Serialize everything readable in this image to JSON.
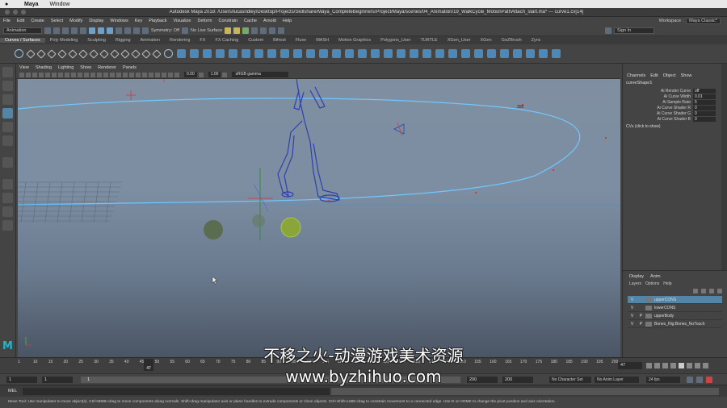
{
  "mac_menu": {
    "apple": "",
    "app": "Maya",
    "window": "Window"
  },
  "title": "Autodesk Maya 2018: /Users/lucasridley/Desktop/Projects/Skillshare/Maya_CompleteBeginners/Project/Maya/scenes/04_Animation/19_WalkCycle_MotionPathAttach_start.ma* --- curve1.cv[14]",
  "menus": [
    "File",
    "Edit",
    "Create",
    "Select",
    "Modify",
    "Display",
    "Windows",
    "Key",
    "Playback",
    "Visualize",
    "Deform",
    "Constrain",
    "Cache",
    "Arnold",
    "Help"
  ],
  "workspace": {
    "label": "Workspace :",
    "value": "Maya Classic*"
  },
  "status_line": {
    "mode": "Animation",
    "symmetry": "Symmetry: Off",
    "live_surface": "No Live Surface",
    "sign_in": "Sign In"
  },
  "shelf_tabs": [
    "Curves / Surfaces",
    "Poly Modeling",
    "Sculpting",
    "Rigging",
    "Animation",
    "Rendering",
    "FX",
    "FX Caching",
    "Custom",
    "Bifrost",
    "Fluxe",
    "MASH",
    "Motion Graphics",
    "Polygons_User",
    "TURTLE",
    "XGen_User",
    "XGen",
    "GoZBrush",
    "Zync"
  ],
  "panel_menu": [
    "View",
    "Shading",
    "Lighting",
    "Show",
    "Renderer",
    "Panels"
  ],
  "panel_tools": {
    "value1": "0.00",
    "value2": "1.00",
    "color_space": "sRGB gamma"
  },
  "viewport": {
    "curve_label": "200"
  },
  "channel_box": {
    "tabs": [
      "Channels",
      "Edit",
      "Object",
      "Show"
    ],
    "object": "curveShape1",
    "attrs": [
      {
        "name": "Ai Render Curve",
        "value": "off"
      },
      {
        "name": "Ai Curve Width",
        "value": "0.01"
      },
      {
        "name": "Ai Sample Rate",
        "value": "5"
      },
      {
        "name": "Ai Curve Shader R",
        "value": "0"
      },
      {
        "name": "Ai Curve Shader G",
        "value": "0"
      },
      {
        "name": "Ai Curve Shader B",
        "value": "0"
      }
    ],
    "cvs": "CVs (click to show)"
  },
  "layer_panel": {
    "tabs": [
      "Display",
      "Anim"
    ],
    "menus": [
      "Layers",
      "Options",
      "Help"
    ],
    "layers": [
      {
        "v": "V",
        "p": "",
        "name": "upperCONS"
      },
      {
        "v": "V",
        "p": "",
        "name": "lowerCONS"
      },
      {
        "v": "V",
        "p": "P",
        "name": "upperBody"
      },
      {
        "v": "V",
        "p": "P",
        "name": "Bones_Rig:Bones_NoTouch"
      }
    ]
  },
  "timeline": {
    "ticks": [
      "1",
      "10",
      "15",
      "20",
      "25",
      "30",
      "35",
      "40",
      "45",
      "50",
      "55",
      "60",
      "65",
      "70",
      "75",
      "80",
      "85",
      "90",
      "95",
      "100",
      "105",
      "110",
      "115",
      "120",
      "125",
      "130",
      "135",
      "140",
      "145",
      "150",
      "155",
      "160",
      "165",
      "170",
      "175",
      "180",
      "185",
      "190",
      "195",
      "200"
    ],
    "current_frame": "47",
    "frame_field": "47"
  },
  "range": {
    "start": "1",
    "playback_start": "1",
    "slider_label": "1",
    "playback_end": "200",
    "end": "200",
    "character_set": "No Character Set",
    "anim_layer": "No Anim Layer",
    "fps": "24 fps"
  },
  "command_line": {
    "label": "MEL"
  },
  "help_line": "Move Tool: Use manipulator to move object(s). Ctrl+MMB+drag to move components along normals. Shift+drag manipulator axis or plane handles to extrude components or clone objects. Ctrl+Shift+LMB+drag to constrain movement to a connected edge. Use D or HOME to change the pivot position and axis orientation.",
  "watermark": "不移之火-动漫游戏美术资源\nwww.byzhihuo.com",
  "colors": {
    "accent": "#5285a6",
    "viewport_top": "#7f8fa1",
    "viewport_bottom": "#4a5564",
    "curve": "#6fc8ff",
    "maya_logo": "#27b3c8"
  }
}
